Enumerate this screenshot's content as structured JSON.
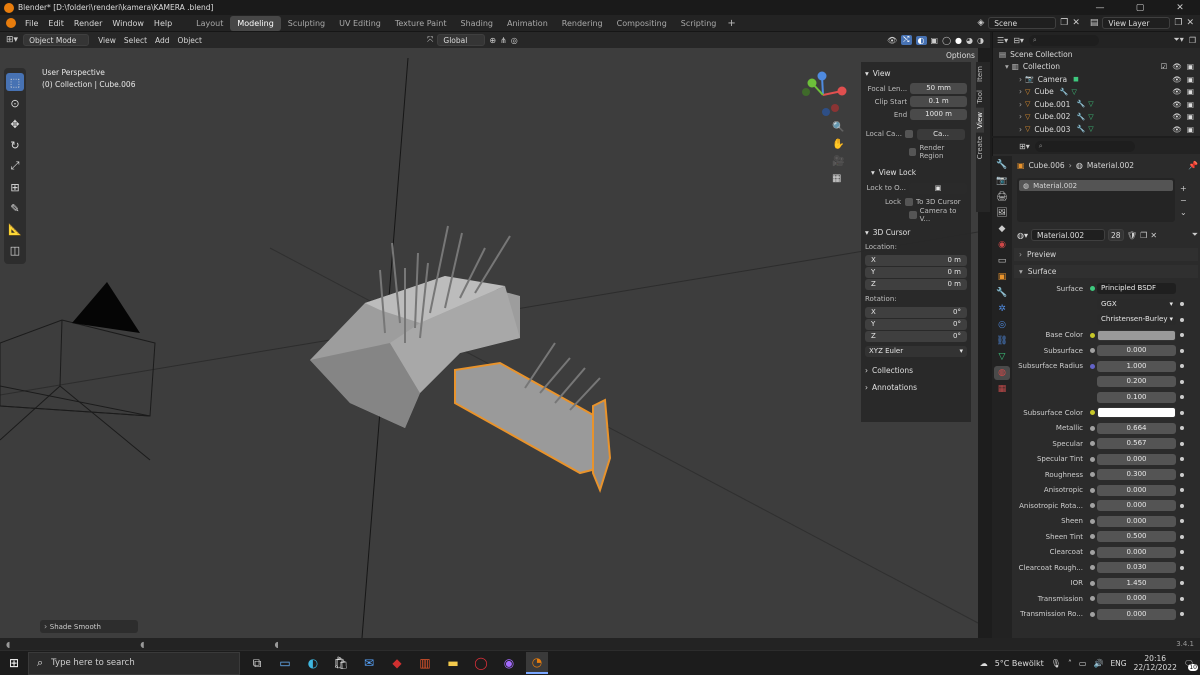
{
  "window": {
    "title": "Blender* [D:\\folderi\\renderi\\kamera\\KAMERA .blend]"
  },
  "menu": {
    "items": [
      "File",
      "Edit",
      "Render",
      "Window",
      "Help"
    ]
  },
  "workspaces": [
    "Layout",
    "Modeling",
    "Sculpting",
    "UV Editing",
    "Texture Paint",
    "Shading",
    "Animation",
    "Rendering",
    "Compositing",
    "Scripting"
  ],
  "active_workspace": "Modeling",
  "scene": {
    "label": "Scene",
    "view_layer": "View Layer"
  },
  "viewport_header": {
    "mode": "Object Mode",
    "menus": [
      "View",
      "Select",
      "Add",
      "Object"
    ],
    "transform": "Global",
    "options": "Options"
  },
  "viewport": {
    "perspective": "User Perspective",
    "context": "(0) Collection | Cube.006",
    "last_op": "Shade Smooth"
  },
  "npanel": {
    "tabs": [
      "Item",
      "Tool",
      "View",
      "Create"
    ],
    "view_title": "View",
    "focal_label": "Focal Len...",
    "focal_value": "50 mm",
    "clip_start_label": "Clip Start",
    "clip_start_value": "0.1 m",
    "clip_end_label": "End",
    "clip_end_value": "1000 m",
    "local_cam_label": "Local Ca...",
    "local_cam_value": "Ca...",
    "render_region": "Render Region",
    "view_lock_title": "View Lock",
    "lock_to_label": "Lock to O...",
    "lock_label": "Lock",
    "to_3d_cursor": "To 3D Cursor",
    "camera_to_view": "Camera to V...",
    "cursor_title": "3D Cursor",
    "location_label": "Location:",
    "loc": [
      {
        "axis": "X",
        "value": "0 m"
      },
      {
        "axis": "Y",
        "value": "0 m"
      },
      {
        "axis": "Z",
        "value": "0 m"
      }
    ],
    "rotation_label": "Rotation:",
    "rot": [
      {
        "axis": "X",
        "value": "0°"
      },
      {
        "axis": "Y",
        "value": "0°"
      },
      {
        "axis": "Z",
        "value": "0°"
      }
    ],
    "rotation_mode": "XYZ Euler",
    "collections": "Collections",
    "annotations": "Annotations"
  },
  "outliner": {
    "root": "Scene Collection",
    "collection": "Collection",
    "items": [
      "Camera",
      "Cube",
      "Cube.001",
      "Cube.002",
      "Cube.003"
    ]
  },
  "properties": {
    "breadcrumb_object": "Cube.006",
    "breadcrumb_material": "Material.002",
    "slot": "Material.002",
    "material_name": "Material.002",
    "users": "28",
    "preview": "Preview",
    "surface_section": "Surface",
    "surface_label": "Surface",
    "surface_value": "Principled BSDF",
    "distribution": "GGX",
    "subsurface_method": "Christensen-Burley",
    "rows": [
      {
        "label": "Base Color",
        "value": "",
        "type": "color",
        "color": "#9a9a9a"
      },
      {
        "label": "Subsurface",
        "value": "0.000",
        "fill": 0
      },
      {
        "label": "Subsurface Radius",
        "value": "1.000",
        "fill": 0
      },
      {
        "label": "",
        "value": "0.200",
        "fill": 0
      },
      {
        "label": "",
        "value": "0.100",
        "fill": 0
      },
      {
        "label": "Subsurface Color",
        "value": "",
        "type": "color",
        "color": "#ffffff"
      },
      {
        "label": "Metallic",
        "value": "0.664",
        "fill": 0.664
      },
      {
        "label": "Specular",
        "value": "0.567",
        "fill": 0.567
      },
      {
        "label": "Specular Tint",
        "value": "0.000",
        "fill": 0
      },
      {
        "label": "Roughness",
        "value": "0.300",
        "fill": 0.3
      },
      {
        "label": "Anisotropic",
        "value": "0.000",
        "fill": 0
      },
      {
        "label": "Anisotropic Rota...",
        "value": "0.000",
        "fill": 0
      },
      {
        "label": "Sheen",
        "value": "0.000",
        "fill": 0
      },
      {
        "label": "Sheen Tint",
        "value": "0.500",
        "fill": 0.5
      },
      {
        "label": "Clearcoat",
        "value": "0.000",
        "fill": 0
      },
      {
        "label": "Clearcoat Rough...",
        "value": "0.030",
        "fill": 0.03
      },
      {
        "label": "IOR",
        "value": "1.450",
        "fill": 0
      },
      {
        "label": "Transmission",
        "value": "0.000",
        "fill": 0
      },
      {
        "label": "Transmission Ro...",
        "value": "0.000",
        "fill": 0
      }
    ]
  },
  "statusbar": {
    "version": "3.4.1"
  },
  "taskbar": {
    "search_placeholder": "Type here to search",
    "weather": "5°C  Bewölkt",
    "lang": "ENG",
    "time": "20:16",
    "date": "22/12/2022",
    "notif": "10"
  }
}
